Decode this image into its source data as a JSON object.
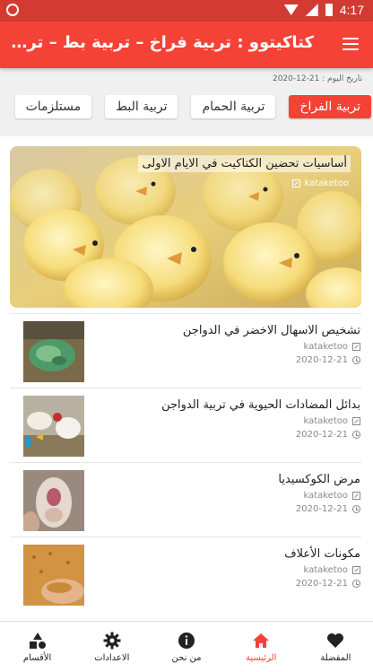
{
  "status_bar": {
    "time": "4:17"
  },
  "app_bar": {
    "title": "كتاكيتوو : تربية فراخ – تربية بط – تربية حمام"
  },
  "date_line": "تاريخ اليوم : 21-12-2020",
  "tabs": [
    {
      "label": "تربية الفراخ",
      "active": true
    },
    {
      "label": "تربية الحمام",
      "active": false
    },
    {
      "label": "تربية البط",
      "active": false
    },
    {
      "label": "مستلزمات",
      "active": false
    }
  ],
  "featured": {
    "title": "أساسيات تحضين الكتاكيت في الايام الاولى",
    "source": "kataketoo"
  },
  "articles": [
    {
      "title": "تشخيص الاسهال الاخضر في الدواجن",
      "source": "kataketoo",
      "date": "2020-12-21",
      "thumb_icon": "green-diarrhea-thumbnail"
    },
    {
      "title": "بدائل المضادات الحيوية في تربية الدواجن",
      "source": "kataketoo",
      "date": "2020-12-21",
      "thumb_icon": "chickens-thumbnail"
    },
    {
      "title": "مرض الكوكسيديا",
      "source": "kataketoo",
      "date": "2020-12-21",
      "thumb_icon": "sick-chick-thumbnail"
    },
    {
      "title": "مكونات الأعلاف",
      "source": "kataketoo",
      "date": "2020-12-21",
      "thumb_icon": "feed-grain-thumbnail"
    }
  ],
  "bottom_nav": {
    "categories": "الأقسام",
    "settings": "الاعدادات",
    "about": "من نحن",
    "home": "الرئيسية",
    "favorites": "المفضلة"
  },
  "colors": {
    "primary": "#f44336",
    "status_bar": "#d33a31",
    "text": "#222222",
    "meta": "#888888"
  }
}
